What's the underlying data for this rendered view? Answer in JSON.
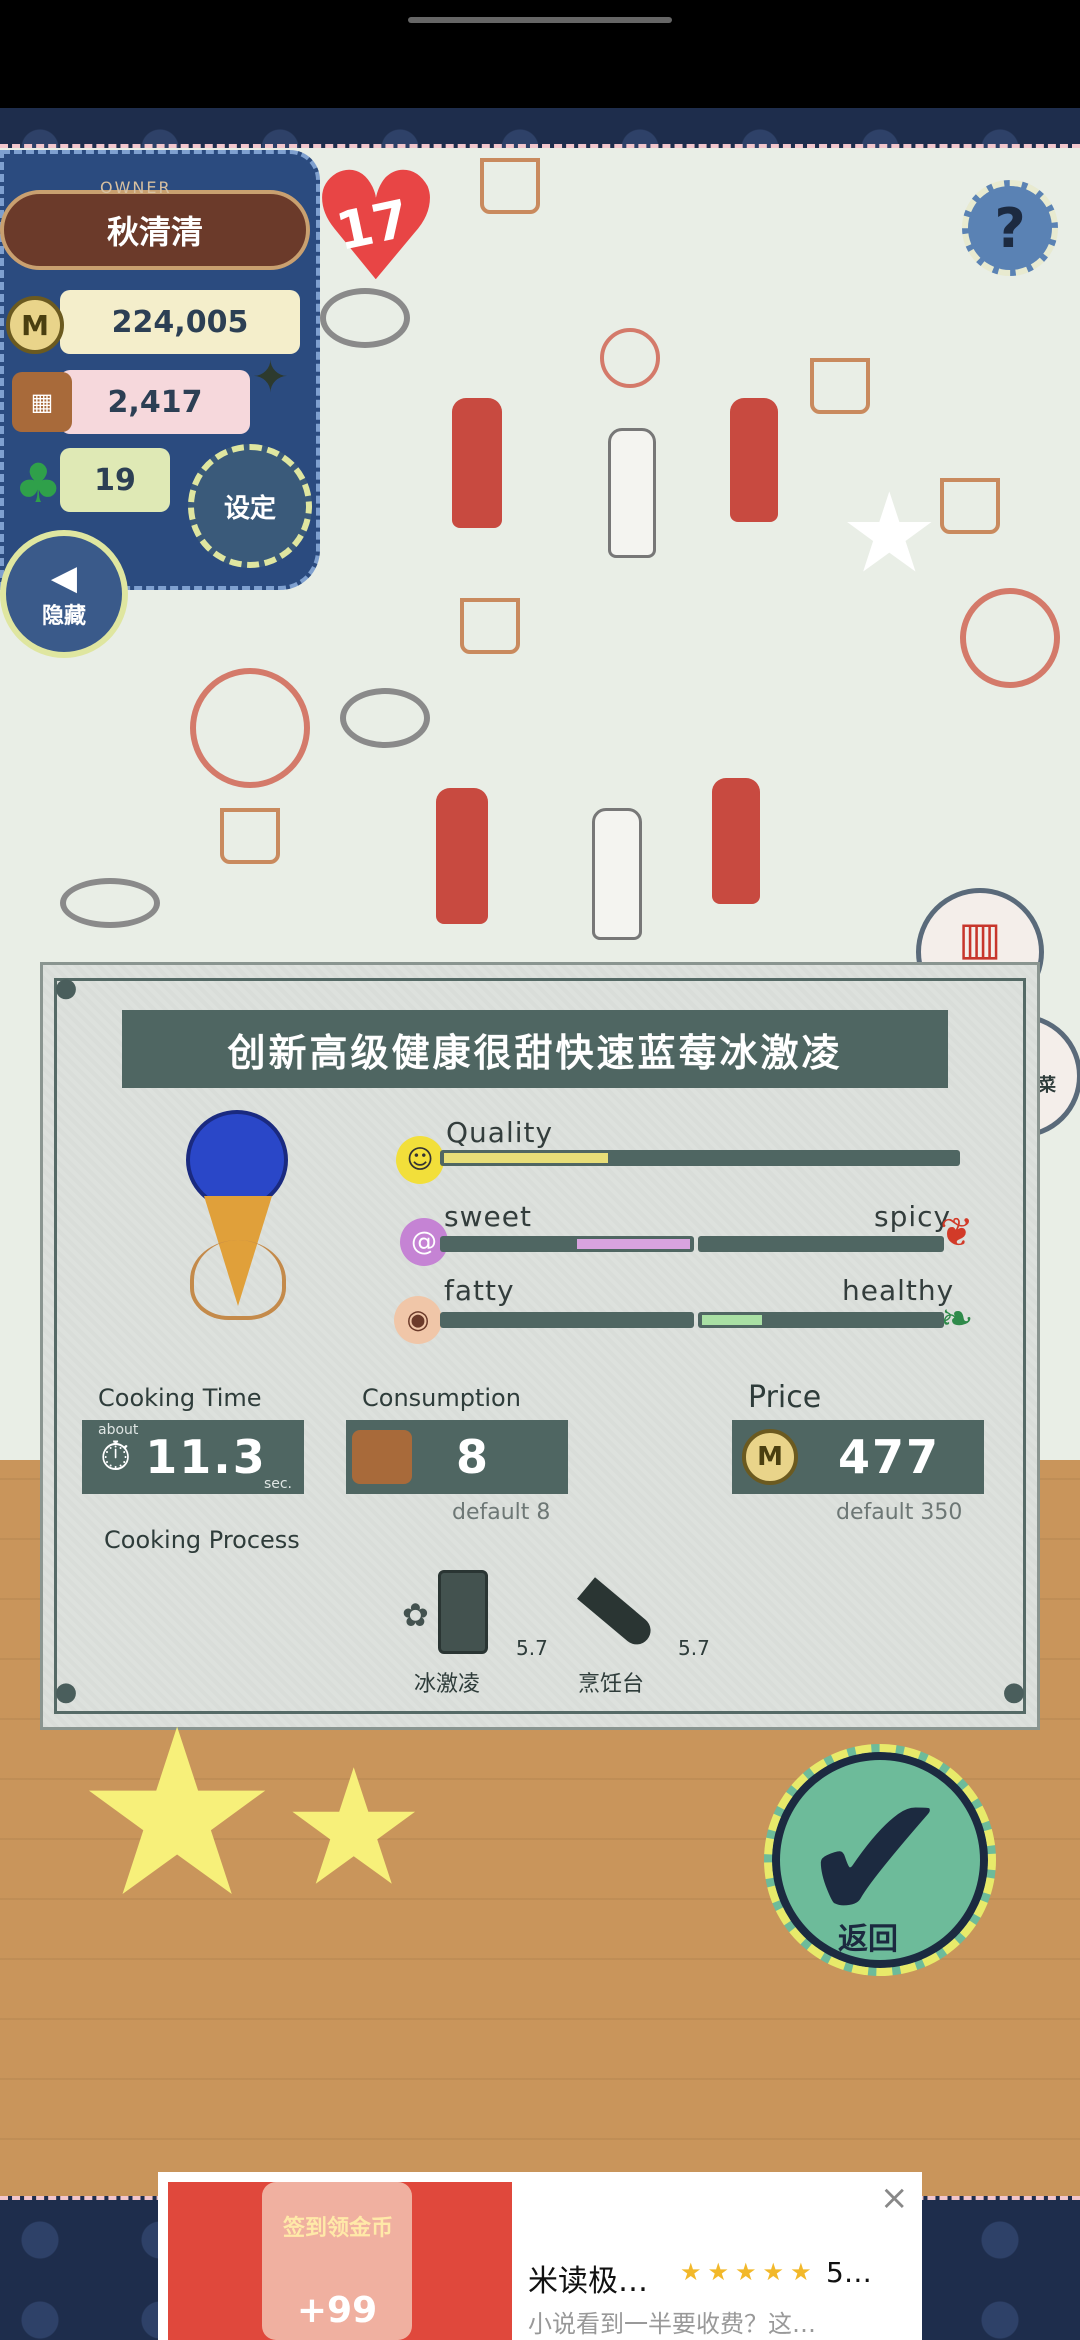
{
  "owner": {
    "tag": "OWNER",
    "name": "秋清清",
    "coins": "224,005",
    "ingredients": "2,417",
    "clovers": "19",
    "level": "17"
  },
  "controls": {
    "settings_label": "设定",
    "hide_label": "隐藏",
    "help_label": "?",
    "trash_label": "忘记",
    "recipe_label": "恢复成菜谱",
    "confirm_label": "返回"
  },
  "dish": {
    "title": "创新高级健康很甜快速蓝莓冰激凌",
    "quality_label": "Quality",
    "quality_level": 0.32,
    "sweet_label": "sweet",
    "spicy_label": "spicy",
    "sweet_level": 0.46,
    "fatty_label": "fatty",
    "healthy_label": "healthy",
    "healthy_level": 0.25,
    "cooking_time_label": "Cooking Time",
    "about_label": "about",
    "cooking_time": "11.3",
    "sec_label": "sec.",
    "consumption_label": "Consumption",
    "consumption": "8",
    "consumption_default": "default 8",
    "price_label": "Price",
    "price": "477",
    "price_default": "default 350",
    "process_label": "Cooking Process",
    "steps": [
      {
        "name": "冰激凌",
        "value": "5.7"
      },
      {
        "name": "烹饪台",
        "value": "5.7"
      }
    ]
  },
  "ad": {
    "image_text": "签到领金币",
    "image_bonus": "+99",
    "title": "米读极…",
    "rating": "5…",
    "description": "小说看到一半要收费？这…",
    "close": "×"
  },
  "colors": {
    "panel_dark": "#4f6662",
    "denim": "#2b4b7f",
    "accent_yellow": "#f7f07a"
  }
}
